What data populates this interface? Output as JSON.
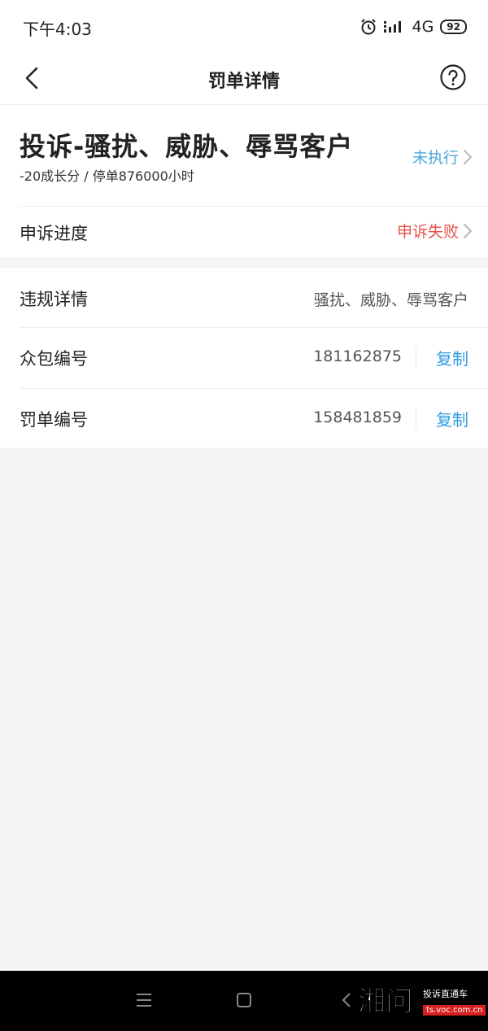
{
  "status_bar": {
    "time": "下午4:03",
    "network": "4G",
    "battery": "92"
  },
  "nav": {
    "title": "罚单详情"
  },
  "penalty": {
    "title": "投诉-骚扰、威胁、辱骂客户",
    "subtitle": "-20成长分 / 停单876000小时",
    "exec_status": "未执行",
    "exec_status_color": "#4aa8dd"
  },
  "appeal": {
    "label": "申诉进度",
    "status": "申诉失败",
    "status_color": "#e5534b"
  },
  "details": {
    "violation_label": "违规详情",
    "violation_value": "骚扰、威胁、辱骂客户",
    "crowd_label": "众包编号",
    "crowd_value": "181162875",
    "ticket_label": "罚单编号",
    "ticket_value": "158481859",
    "copy_label": "复制",
    "copy_color": "#2f9be0"
  },
  "watermark": {
    "logo": "湘问",
    "text": "投诉直通车",
    "url": "ts.voc.com.cn"
  },
  "icons": [
    "alarm-icon",
    "signal-icon",
    "battery-icon",
    "back-arrow-icon",
    "help-icon",
    "chevron-right-icon",
    "menu-icon",
    "home-icon",
    "system-back-icon"
  ]
}
